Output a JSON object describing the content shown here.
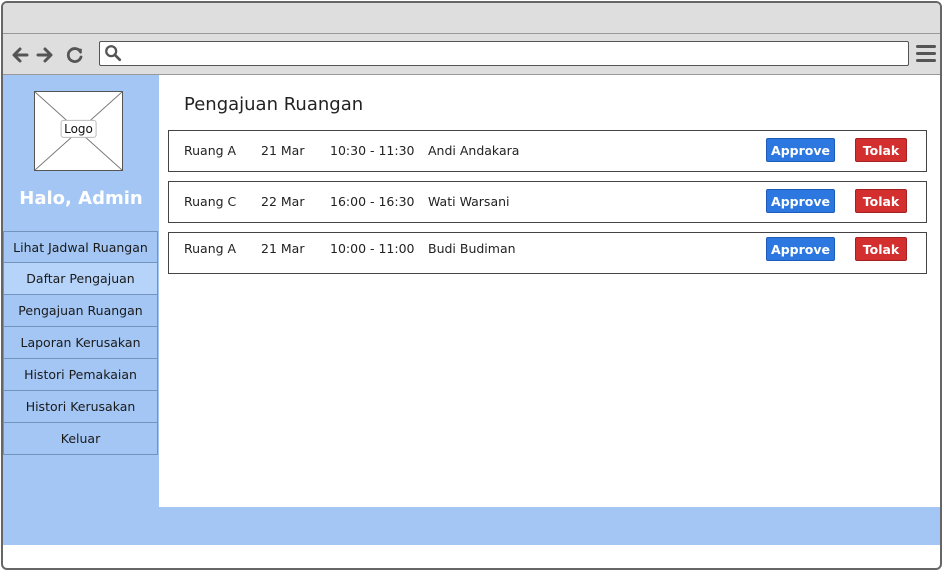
{
  "browser": {
    "address_value": "",
    "icons": [
      "back-arrow-icon",
      "forward-arrow-icon",
      "reload-icon",
      "search-icon",
      "hamburger-menu-icon"
    ]
  },
  "sidebar": {
    "logo_label": "Logo",
    "greeting": "Halo, Admin",
    "items": [
      {
        "label": "Lihat Jadwal Ruangan"
      },
      {
        "label": "Daftar Pengajuan"
      },
      {
        "label": "Pengajuan Ruangan"
      },
      {
        "label": "Laporan Kerusakan"
      },
      {
        "label": "Histori Pemakaian"
      },
      {
        "label": "Histori Kerusakan"
      },
      {
        "label": "Keluar"
      }
    ]
  },
  "main": {
    "title": "Pengajuan Ruangan",
    "approve_label": "Approve",
    "reject_label": "Tolak",
    "requests": [
      {
        "room": "Ruang A",
        "date": "21 Mar",
        "time": "10:30 - 11:30",
        "name": "Andi Andakara"
      },
      {
        "room": "Ruang C",
        "date": "22 Mar",
        "time": "16:00 - 16:30",
        "name": "Wati Warsani"
      },
      {
        "room": "Ruang A",
        "date": "21 Mar",
        "time": "10:00 - 11:00",
        "name": "Budi Budiman"
      }
    ]
  },
  "colors": {
    "sidebar_bg": "#a3c6f5",
    "approve": "#2c78e0",
    "reject": "#d32f2f"
  }
}
